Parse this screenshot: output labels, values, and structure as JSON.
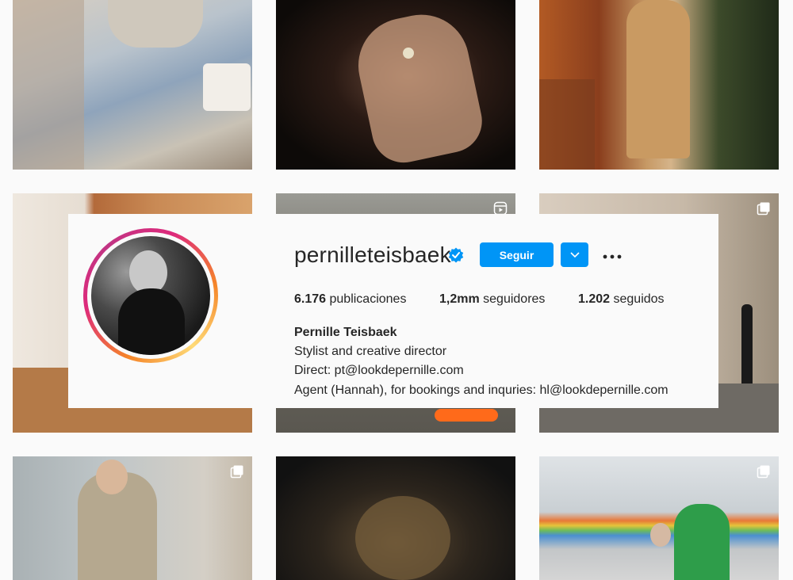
{
  "profile": {
    "username": "pernilleteisbaek",
    "verified": true,
    "follow_label": "Seguir",
    "stats": {
      "posts_value": "6.176",
      "posts_label": "publicaciones",
      "followers_value": "1,2mm",
      "followers_label": "seguidores",
      "following_value": "1.202",
      "following_label": "seguidos"
    },
    "bio": {
      "name": "Pernille Teisbaek",
      "line1": "Stylist and creative director",
      "line2": "Direct: pt@lookdepernille.com",
      "line3": "Agent (Hannah), for bookings and inquries: hl@lookdepernille.com"
    }
  },
  "icons": {
    "verified": "verified-badge-icon",
    "dropdown": "chevron-down-icon",
    "more": "more-options-icon",
    "reel": "reel-icon",
    "carousel": "carousel-icon"
  },
  "colors": {
    "accent": "#0095f6",
    "text": "#262626",
    "background": "#fafafa",
    "ring_start": "#f58529",
    "ring_end": "#dd2a7b"
  },
  "grid": {
    "posts": [
      {
        "badge": "none"
      },
      {
        "badge": "none"
      },
      {
        "badge": "none"
      },
      {
        "badge": "none"
      },
      {
        "badge": "reel"
      },
      {
        "badge": "carousel"
      },
      {
        "badge": "carousel"
      },
      {
        "badge": "none"
      },
      {
        "badge": "carousel"
      }
    ]
  }
}
